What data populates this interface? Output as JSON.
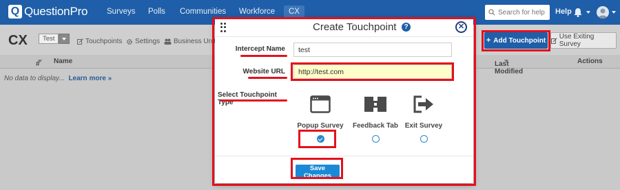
{
  "app": {
    "logo_text": "QuestionPro",
    "nav": [
      "Surveys",
      "Polls",
      "Communities",
      "Workforce",
      "CX"
    ],
    "search_placeholder": "Search for help",
    "help": "Help"
  },
  "page": {
    "title": "CX",
    "survey_select": "Test",
    "subnav": [
      "Touchpoints",
      "Settings",
      "Business Unit"
    ],
    "add_touchpoint": "Add Touchpoint",
    "use_existing": "Use Exiting Survey",
    "table": {
      "columns": [
        "#",
        "Name",
        "Last Modified",
        "Actions"
      ],
      "empty_text": "No data to display...",
      "learn_more": "Learn more »"
    }
  },
  "modal": {
    "title": "Create Touchpoint",
    "intercept_label": "Intercept Name",
    "intercept_value": "test",
    "url_label": "Website URL",
    "url_value": "http://test.com",
    "type_label": "Select Touchpoint Type",
    "types": [
      {
        "label": "Popup Survey",
        "icon": "popup-window-icon",
        "selected": true
      },
      {
        "label": "Feedback Tab",
        "icon": "feedback-tab-icon",
        "selected": false
      },
      {
        "label": "Exit Survey",
        "icon": "exit-arrow-icon",
        "selected": false
      }
    ],
    "save": "Save Changes"
  },
  "colors": {
    "brand": "#1f5ea8",
    "annotation": "#e3101c",
    "url_field_bg": "#fdfdc9",
    "radio": "#2a88c9"
  }
}
